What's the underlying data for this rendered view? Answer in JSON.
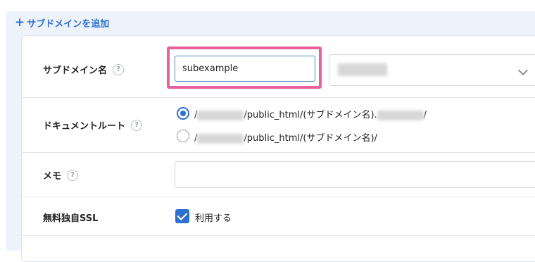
{
  "add_subdomain": {
    "icon": "plus-icon",
    "label": "サブドメインを追加"
  },
  "form": {
    "subdomain": {
      "label": "サブドメイン名",
      "value": "subexample",
      "domain_select_icon": "chevron-down-icon"
    },
    "document_root": {
      "label": "ドキュメントルート",
      "options": [
        {
          "prefix": "/",
          "mid": "/public_html/(サブドメイン名).",
          "suffix": "/",
          "selected": true
        },
        {
          "prefix": "/",
          "mid": "/public_html/(サブドメイン名)/",
          "suffix": "",
          "selected": false
        }
      ]
    },
    "memo": {
      "label": "メモ",
      "value": ""
    },
    "free_ssl": {
      "label": "無料独自SSL",
      "checkbox_label": "利用する",
      "checked": true
    }
  },
  "help_icon_glyph": "?",
  "colors": {
    "accent": "#2f6fd0",
    "highlight": "#e8609b"
  }
}
